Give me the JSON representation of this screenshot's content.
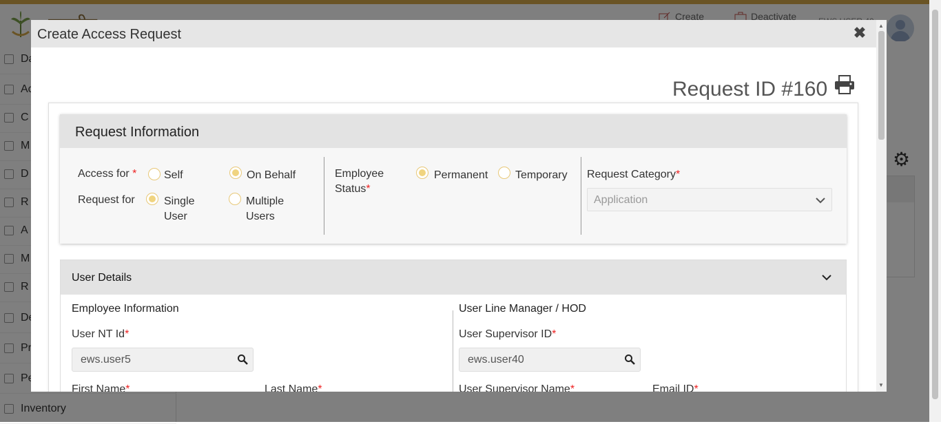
{
  "header": {
    "create_label": "Create",
    "deactivate_label": "Deactivate",
    "user_label": "EWS USER 40"
  },
  "sidebar": {
    "items": [
      {
        "label": "Da"
      },
      {
        "label": "Ac"
      },
      {
        "label": "C"
      },
      {
        "label": "M"
      },
      {
        "label": "D"
      },
      {
        "label": "R"
      },
      {
        "label": "A"
      },
      {
        "label": "M"
      },
      {
        "label": "R"
      },
      {
        "label": "De"
      },
      {
        "label": "Pr"
      },
      {
        "label": "Pe"
      },
      {
        "label": "Inventory"
      }
    ]
  },
  "modal": {
    "title": "Create Access Request",
    "close_symbol": "✖",
    "request_id": "Request ID #160",
    "request_information": {
      "title": "Request Information",
      "access_for_label": "Access for",
      "access_for_options": [
        {
          "label": "Self",
          "selected": false
        },
        {
          "label": "On Behalf",
          "selected": true
        }
      ],
      "request_for_label": "Request for",
      "request_for_options": [
        {
          "label_line1": "Single",
          "label_line2": "User",
          "selected": true
        },
        {
          "label_line1": "Multiple",
          "label_line2": "Users",
          "selected": false
        }
      ],
      "employee_status_label_line1": "Employee",
      "employee_status_label_line2": "Status",
      "employee_status_options": [
        {
          "label": "Permanent",
          "selected": true
        },
        {
          "label": "Temporary",
          "selected": false
        }
      ],
      "request_category_label": "Request Category",
      "request_category_value": "Application"
    },
    "user_details": {
      "title": "User Details",
      "employee_information_title": "Employee Information",
      "user_nt_id_label": "User NT Id",
      "user_nt_id_value": "ews.user5",
      "first_name_label": "First Name",
      "last_name_label": "Last Name",
      "line_manager_title": "User Line Manager / HOD",
      "supervisor_id_label": "User Supervisor ID",
      "supervisor_id_value": "ews.user40",
      "supervisor_name_label": "User Supervisor Name",
      "email_id_label": "Email ID"
    },
    "required_mark": "*"
  },
  "colors": {
    "accent_stripe": "#d4a84a",
    "radio_selected": "#f0d480",
    "required": "#ee2222"
  }
}
